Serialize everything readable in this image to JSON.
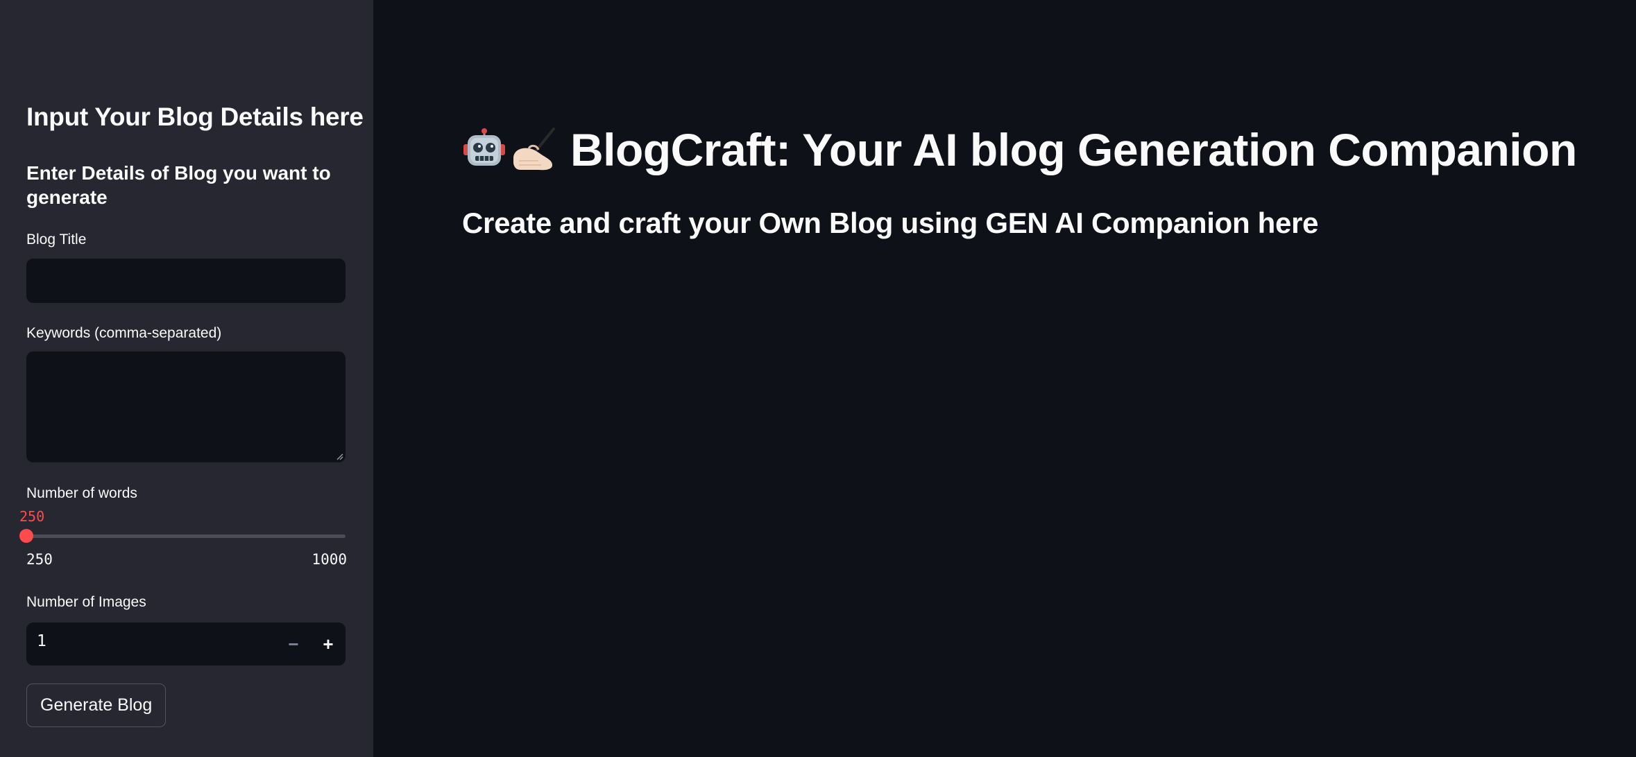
{
  "sidebar": {
    "header": "Input Your Blog Details here",
    "subheader": "Enter Details of Blog you want to generate",
    "blog_title": {
      "label": "Blog Title",
      "value": "",
      "placeholder": ""
    },
    "keywords": {
      "label": "Keywords (comma-separated)",
      "value": "",
      "placeholder": ""
    },
    "num_words": {
      "label": "Number of words",
      "value": 250,
      "value_text": "250",
      "min": 250,
      "max": 1000,
      "min_text": "250",
      "max_text": "1000"
    },
    "num_images": {
      "label": "Number of Images",
      "value": "1",
      "minus_label": "−",
      "plus_label": "+"
    },
    "generate_button": "Generate Blog"
  },
  "main": {
    "title_icons": [
      "robot-icon",
      "writing-hand-icon"
    ],
    "title": "BlogCraft: Your AI blog Generation Companion",
    "subtitle": "Create and craft your Own Blog using GEN AI Companion here"
  },
  "colors": {
    "accent": "#ff4b4b",
    "sidebar_bg": "#262730",
    "main_bg": "#0e1117",
    "input_bg": "#0e1117",
    "text": "#fafafa"
  }
}
